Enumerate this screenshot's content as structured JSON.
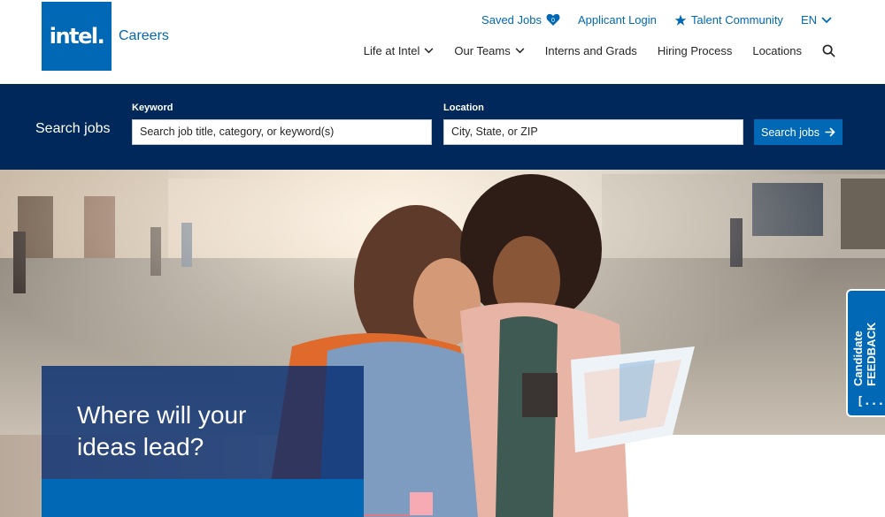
{
  "header": {
    "logo": "intel.",
    "brand": "Careers",
    "utility_nav": {
      "saved_jobs": "Saved Jobs",
      "saved_jobs_count": "0",
      "applicant_login": "Applicant Login",
      "talent_community": "Talent Community",
      "language": "EN"
    },
    "main_nav": [
      {
        "label": "Life at Intel"
      },
      {
        "label": "Our Teams"
      },
      {
        "label": "Interns and Grads"
      },
      {
        "label": "Hiring Process"
      },
      {
        "label": "Locations"
      }
    ]
  },
  "search": {
    "heading": "Search jobs",
    "keyword_label": "Keyword",
    "keyword_placeholder": "Search job title, category, or keyword(s)",
    "location_label": "Location",
    "location_placeholder": "City, State, or ZIP",
    "button_label": "Search jobs"
  },
  "hero": {
    "title_line1": "Where will your",
    "title_line2": "ideas lead?"
  },
  "feedback": {
    "line1": "Candidate",
    "line2": "FEEDBACK",
    "icon": "[...]"
  },
  "colors": {
    "brand_blue": "#0068b5",
    "navy": "#00285a",
    "accent_pink": "#f7a9b4"
  },
  "icons": [
    "heart-icon",
    "star-icon",
    "chevron-down-icon",
    "search-icon",
    "arrow-right-icon"
  ]
}
